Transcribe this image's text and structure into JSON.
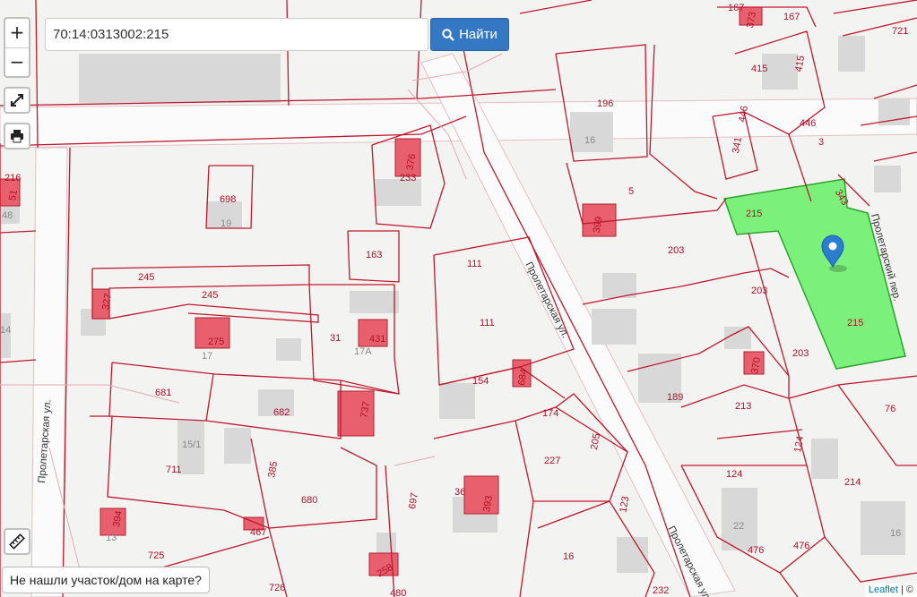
{
  "search": {
    "value": "70:14:0313002:215",
    "button_label": "Найти"
  },
  "controls": {
    "zoom_in": "+",
    "zoom_out": "−"
  },
  "not_found_label": "Не нашли участок/дом на карте?",
  "attribution": {
    "leaflet": "Leaflet",
    "sep": " | ©"
  },
  "colors": {
    "selected_parcel": "#7bf07b",
    "parcel_border": "#c0182e",
    "marker": "#2a7dd1",
    "building_highlight": "#e8606e"
  },
  "streets": {
    "proletarskaya": "Пролетарская ул.",
    "proletarsky_per": "Пролетарский пер."
  },
  "parcel_labels": {
    "p216": "216",
    "p5x": "51",
    "p48": "48",
    "p698": "698",
    "p19": "19",
    "p376": "376",
    "p233": "233",
    "p196": "196",
    "p16a": "16",
    "p5": "5",
    "p399": "399",
    "p446a": "446",
    "p446b": "446",
    "p3": "3",
    "p341": "341",
    "p373": "373",
    "p167a": "167",
    "p167b": "167",
    "p415a": "415",
    "p415b": "415",
    "p721": "721",
    "p343": "343",
    "p215a": "215",
    "p215b": "215",
    "p163": "163",
    "p245a": "245",
    "p245b": "245",
    "p327": "327",
    "p111a": "111",
    "p111b": "111",
    "p203a": "203",
    "p203b": "203",
    "p203c": "203",
    "p275": "275",
    "p17": "17",
    "p31": "31",
    "p431": "431",
    "p17a": "17А",
    "p14": "14",
    "p154": "154",
    "p684": "684",
    "p370": "370",
    "p189": "189",
    "p681": "681",
    "p682": "682",
    "p737": "737",
    "p213": "213",
    "p76": "76",
    "p174": "174",
    "p205": "205",
    "p15_1": "15/1",
    "p711": "711",
    "p385": "385",
    "p227": "227",
    "p124a": "124",
    "p124b": "124",
    "p214": "214",
    "p680": "680",
    "p697": "697",
    "p36": "36",
    "p393": "393",
    "p123": "123",
    "p394": "394",
    "p13": "13",
    "p467": "467",
    "p725": "725",
    "p22": "22",
    "p476a": "476",
    "p476b": "476",
    "p16b": "16",
    "p16c": "16",
    "p258": "258",
    "p726": "726",
    "p480": "480",
    "p232": "232"
  }
}
